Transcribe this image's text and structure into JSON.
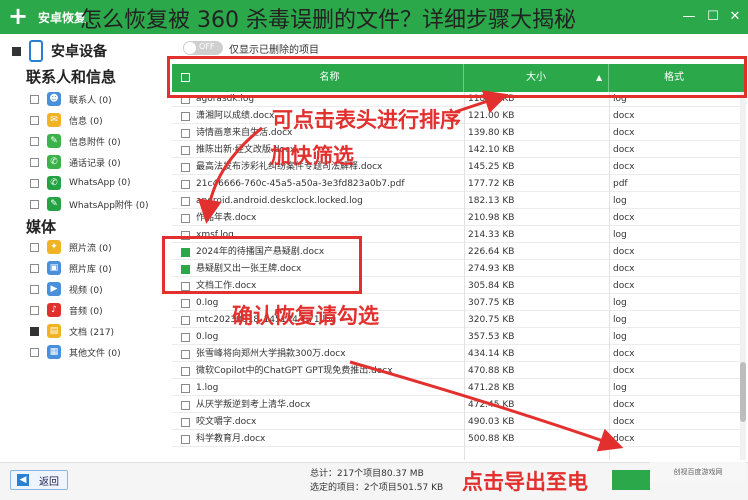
{
  "window": {
    "app_title": "安卓恢复",
    "overlay_title": "怎么恢复被 360 杀毒误删的文件？详细步骤大揭秘"
  },
  "sidebar": {
    "device": "安卓设备",
    "sections": [
      {
        "title": "联系人和信息",
        "items": [
          {
            "label": "联系人 (0)",
            "icon": "contact-icon",
            "color": "#4a8fd9"
          },
          {
            "label": "信息 (0)",
            "icon": "message-icon",
            "color": "#f0b323"
          },
          {
            "label": "信息附件 (0)",
            "icon": "attachment-icon",
            "color": "#3cb34a"
          },
          {
            "label": "通话记录 (0)",
            "icon": "call-log-icon",
            "color": "#3cb34a"
          },
          {
            "label": "WhatsApp (0)",
            "icon": "whatsapp-icon",
            "color": "#25a244"
          },
          {
            "label": "WhatsApp附件 (0)",
            "icon": "whatsapp-attachment-icon",
            "color": "#25a244"
          }
        ]
      },
      {
        "title": "媒体",
        "items": [
          {
            "label": "照片流 (0)",
            "icon": "photo-stream-icon",
            "color": "#f0b323"
          },
          {
            "label": "照片库 (0)",
            "icon": "photo-library-icon",
            "color": "#4a8fd9"
          },
          {
            "label": "视频 (0)",
            "icon": "video-icon",
            "color": "#4a8fd9"
          },
          {
            "label": "音频 (0)",
            "icon": "audio-icon",
            "color": "#e2302e"
          },
          {
            "label": "文档 (217)",
            "icon": "document-icon",
            "color": "#f0b323"
          },
          {
            "label": "其他文件 (0)",
            "icon": "other-files-icon",
            "color": "#4a8fd9"
          }
        ]
      }
    ]
  },
  "toggle": {
    "state": "OFF",
    "label": "仅显示已删除的项目"
  },
  "table": {
    "headers": {
      "name": "名称",
      "size": "大小",
      "format": "格式"
    },
    "rows": [
      {
        "name": "agorasdk.log",
        "size": "118.01 KB",
        "format": "log",
        "checked": false
      },
      {
        "name": "潇湘阿以成绩.docx",
        "size": "121.00 KB",
        "format": "docx",
        "checked": false
      },
      {
        "name": "诗情画意来自生活.docx",
        "size": "139.80 KB",
        "format": "docx",
        "checked": false
      },
      {
        "name": "推陈出新·经文改版.docx",
        "size": "142.10 KB",
        "format": "docx",
        "checked": false
      },
      {
        "name": "最高法发布涉彩礼纠纷案件专题司法解释.docx",
        "size": "145.25 KB",
        "format": "docx",
        "checked": false
      },
      {
        "name": "21c46666-760c-45a5-a50a-3e3fd823a0b7.pdf",
        "size": "177.72 KB",
        "format": "pdf",
        "checked": false
      },
      {
        "name": "android.android.deskclock.locked.log",
        "size": "182.13 KB",
        "format": "log",
        "checked": false
      },
      {
        "name": "作品年表.docx",
        "size": "210.98 KB",
        "format": "docx",
        "checked": false
      },
      {
        "name": "xmsf.log",
        "size": "214.33 KB",
        "format": "log",
        "checked": false
      },
      {
        "name": "2024年的待播国产悬疑剧.docx",
        "size": "226.64 KB",
        "format": "docx",
        "checked": true
      },
      {
        "name": "悬疑剧又出一张王牌.docx",
        "size": "274.93 KB",
        "format": "docx",
        "checked": true
      },
      {
        "name": "文档工作.docx",
        "size": "305.84 KB",
        "format": "docx",
        "checked": false
      },
      {
        "name": "0.log",
        "size": "307.75 KB",
        "format": "log",
        "checked": false
      },
      {
        "name": "mtc20230818_145144_671.log",
        "size": "320.75 KB",
        "format": "log",
        "checked": false
      },
      {
        "name": "0.log",
        "size": "357.53 KB",
        "format": "log",
        "checked": false
      },
      {
        "name": "张雪峰将向郑州大学捐款300万.docx",
        "size": "434.14 KB",
        "format": "docx",
        "checked": false
      },
      {
        "name": "微软Copilot中的ChatGPT GPT现免费推出.docx",
        "size": "470.88 KB",
        "format": "docx",
        "checked": false
      },
      {
        "name": "1.log",
        "size": "471.28 KB",
        "format": "log",
        "checked": false
      },
      {
        "name": "从厌学叛逆到考上清华.docx",
        "size": "472.45 KB",
        "format": "docx",
        "checked": false
      },
      {
        "name": "咬文嚼字.docx",
        "size": "490.03 KB",
        "format": "docx",
        "checked": false
      },
      {
        "name": "科学教育月.docx",
        "size": "500.88 KB",
        "format": "docx",
        "checked": false
      }
    ]
  },
  "footer": {
    "back_label": "返回",
    "total": "总计：217个项目80.37 MB",
    "selected": "选定的项目：2个项目501.57 KB",
    "watermark": "创视百度游戏网"
  },
  "annotations": {
    "sort_tip_line1": "可点击表头进行排序",
    "sort_tip_line2": "加快筛选",
    "check_tip": "确认恢复请勾选",
    "export_tip": "点击导出至电"
  },
  "colors": {
    "brand_green": "#2aa84a",
    "annotation_red": "#e2302e"
  }
}
